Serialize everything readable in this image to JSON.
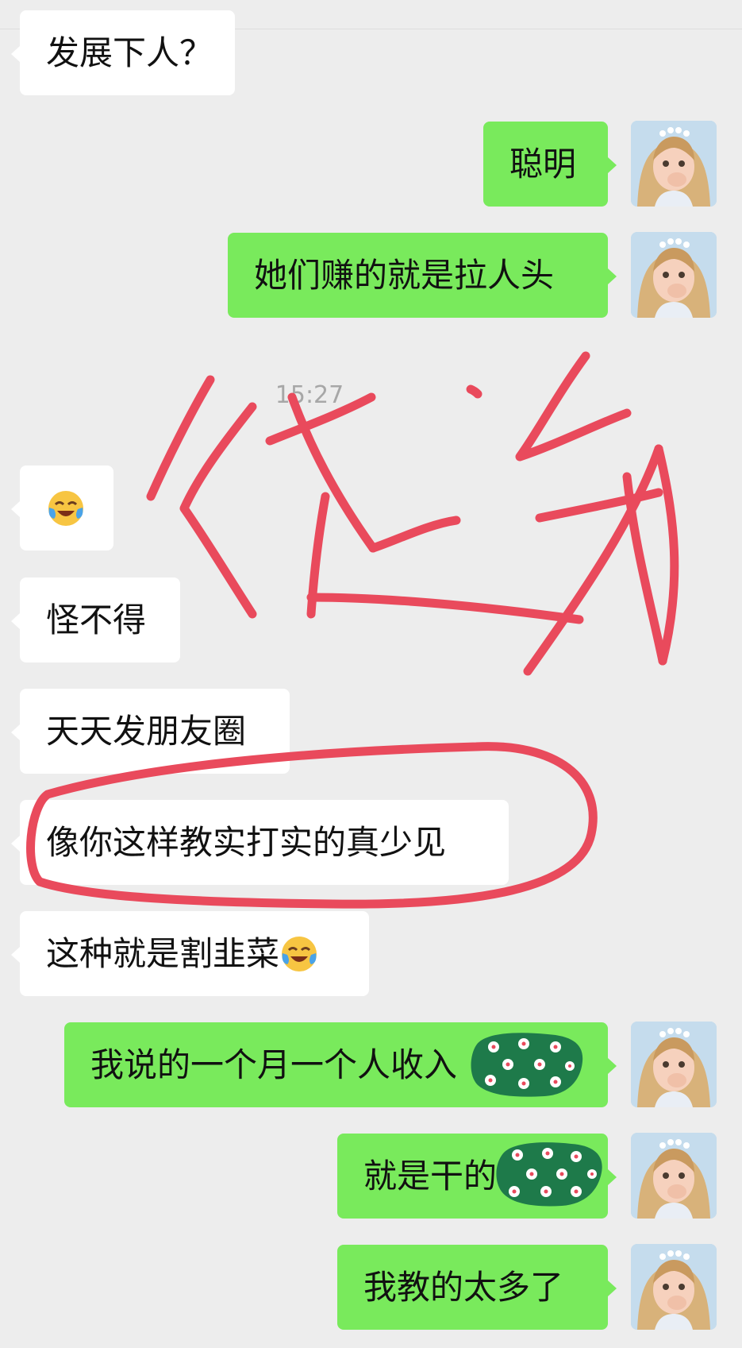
{
  "timestamp": "15:27",
  "colors": {
    "background": "#ededed",
    "incoming_bubble": "#ffffff",
    "outgoing_bubble": "#79ea5c",
    "annotation": "#e94a5c",
    "censor_sticker": "#1e7a4a"
  },
  "icons": {
    "emoji": "tears-of-joy-emoji",
    "avatar": "girl-photo-avatar",
    "censor": "flower-sticker"
  },
  "messages": [
    {
      "side": "in",
      "text": "发展下人？"
    },
    {
      "side": "out",
      "text": "聪明"
    },
    {
      "side": "out",
      "text": "她们赚的就是拉人头"
    },
    {
      "side": "in",
      "text": ""
    },
    {
      "side": "in",
      "text": "怪不得"
    },
    {
      "side": "in",
      "text": "天天发朋友圈"
    },
    {
      "side": "in",
      "text": "像你这样教实打实的真少见"
    },
    {
      "side": "in",
      "text": "这种就是割韭菜"
    },
    {
      "side": "out",
      "text": "我说的一个月一个人收入"
    },
    {
      "side": "out",
      "text": "就是干的"
    },
    {
      "side": "out",
      "text": "我教的太多了"
    }
  ]
}
